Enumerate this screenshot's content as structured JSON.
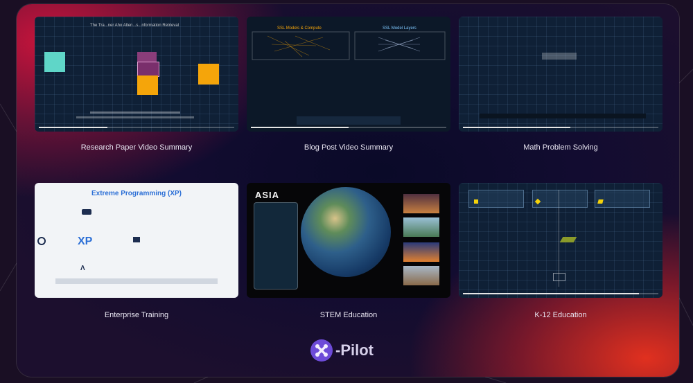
{
  "cards": [
    {
      "label": "Research Paper Video Summary",
      "video_title": "The Tra...ner Aho Alten...s...nformation Retrieval",
      "caption": "...",
      "progress": 0.35
    },
    {
      "label": "Blog Post Video Summary",
      "left_title": "SSL Models & Compute",
      "right_title": "SSL Model Layers",
      "progress": 0.5
    },
    {
      "label": "Math Problem Solving",
      "progress": 0.55
    },
    {
      "label": "Enterprise Training",
      "title": "Extreme Programming (XP)",
      "center_text": "XP"
    },
    {
      "label": "STEM Education",
      "heading": "ASIA"
    },
    {
      "label": "K-12 Education",
      "progress": 0.9
    }
  ],
  "brand": {
    "name": "-Pilot"
  },
  "colors": {
    "accent": "#6d4bd8",
    "gold": "#f5a50a",
    "teal": "#5fd6c8",
    "xp_blue": "#2c6fd6"
  }
}
